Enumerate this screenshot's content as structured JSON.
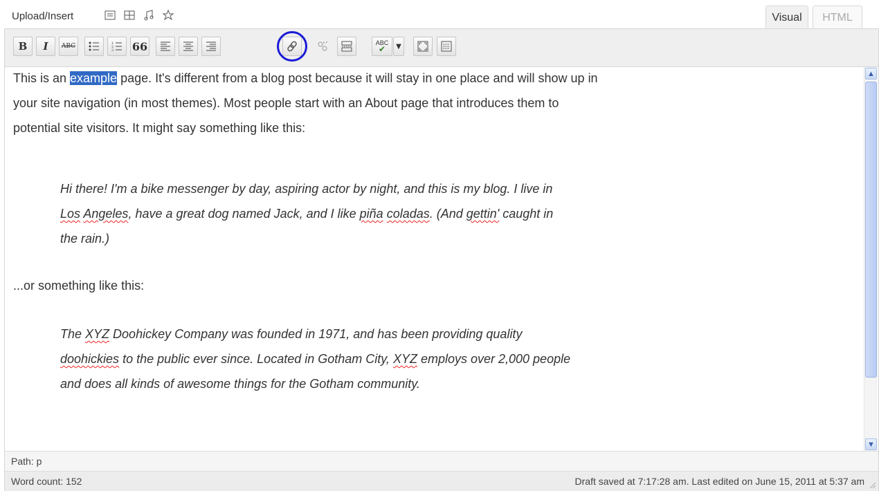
{
  "top": {
    "upload_label": "Upload/Insert",
    "media_icons": [
      "image-icon",
      "video-icon",
      "audio-icon",
      "media-icon"
    ]
  },
  "tabs": {
    "visual": "Visual",
    "html": "HTML"
  },
  "toolbar": {
    "bold": "B",
    "italic": "I",
    "strike": "ABC",
    "blockquote": "66",
    "spellcheck": "ABC",
    "icons": [
      "bold-icon",
      "italic-icon",
      "strikethrough-icon",
      "bullet-list-icon",
      "numbered-list-icon",
      "blockquote-icon",
      "align-left-icon",
      "align-center-icon",
      "align-right-icon",
      "insert-link-icon",
      "unlink-icon",
      "more-tag-icon",
      "spellcheck-icon",
      "fullscreen-icon",
      "kitchen-sink-icon"
    ],
    "highlight_color": "#1a1ad6"
  },
  "content": {
    "p1_before": "This is an ",
    "p1_selected": "example",
    "p1_after": " page. It's different from a blog post because it will stay in one place and will show up in your site navigation (in most themes). Most people start with an About page that introduces them to potential site visitors. It might say something like this:",
    "q1_a": "Hi there! I'm a bike messenger by day, aspiring actor by night, and this is my blog. I live in ",
    "q1_los": "Los",
    "q1_sp1": " ",
    "q1_angeles": "Angeles",
    "q1_b": ", have a great dog named Jack, and I like ",
    "q1_pina": "piña",
    "q1_sp2": " ",
    "q1_coladas": "coladas",
    "q1_c": ". (And ",
    "q1_gettin": "gettin'",
    "q1_d": " caught in the rain.)",
    "p2": "...or something like this:",
    "q2_a": "The ",
    "q2_xyz1": "XYZ",
    "q2_b": " Doohickey Company was founded in 1971, and has been providing quality ",
    "q2_doohickies": "doohickies",
    "q2_c": " to the public ever since. Located in Gotham City, ",
    "q2_xyz2": "XYZ",
    "q2_d": " employs over 2,000 people and does all kinds of awesome things for the Gotham community."
  },
  "path": "Path: p",
  "status": {
    "word_count": "Word count: 152",
    "draft": "Draft saved at 7:17:28 am. Last edited on June 15, 2011 at 5:37 am"
  },
  "colors": {
    "selection": "#316ac5",
    "spell_underline": "#e22"
  }
}
